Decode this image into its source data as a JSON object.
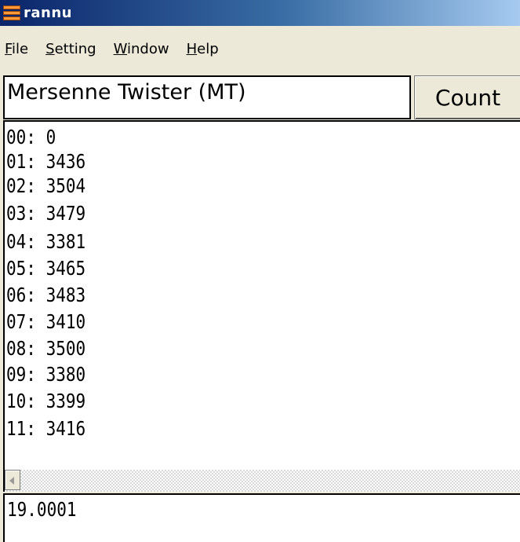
{
  "window": {
    "title": "rannu"
  },
  "menu": [
    {
      "key": "F",
      "rest": "ile"
    },
    {
      "key": "S",
      "rest": "etting"
    },
    {
      "key": "W",
      "rest": "indow"
    },
    {
      "key": "H",
      "rest": "elp"
    }
  ],
  "generator": {
    "selected": "Mersenne Twister (MT)"
  },
  "count_button": "Count",
  "counts": [
    "00: 0",
    "01: 3436",
    "02: 3504",
    "03: 3479",
    "04: 3381",
    "05: 3465",
    "06: 3483",
    "07: 3410",
    "08: 3500",
    "09: 3380",
    "10: 3399",
    "11: 3416"
  ],
  "result": "19.0001"
}
